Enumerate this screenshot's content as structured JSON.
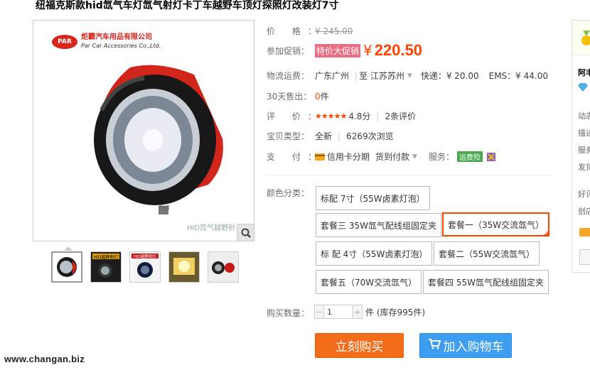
{
  "product": {
    "title": "纽福克斯款hid氙气车灯氙气射灯卡丁车越野车顶灯探照灯改装灯7寸"
  },
  "gallery": {
    "brand_logo": "PAR",
    "brand_cn": "炬霸汽车用品有限公司",
    "brand_en": "Par Car Accessories Co.,Ltd.",
    "watermark": "HID氙气越野射",
    "lamp_label": "PAR",
    "thumb1_banner": "HID越野射灯",
    "thumb3_banner": "HID越野射灯"
  },
  "price": {
    "label": "价 格：",
    "original": "¥ 245.00",
    "promo_label": "参加促销：",
    "promo_tag": "特价大促销",
    "currency": "¥",
    "current": "220.50"
  },
  "shipping": {
    "label": "物流运费：",
    "from": "广东广州",
    "to": "至 江苏苏州",
    "express": "快递：¥ 20.00",
    "ems": "EMS：¥ 44.00"
  },
  "sales": {
    "label": "30天售出：",
    "count": "0",
    "unit": "件"
  },
  "rating": {
    "label": "评 价：",
    "stars": "★★★★★",
    "score": "4.8分",
    "reviews": "2条评价"
  },
  "info": {
    "label": "宝贝类型：",
    "type": "全新",
    "views": "6269次浏览"
  },
  "payment": {
    "label": "支 付：",
    "credit": "信用卡分期",
    "cod": "货到付款",
    "service_label": "服务：",
    "service_badge": "运费险"
  },
  "sku": {
    "label": "颜色分类：",
    "options": [
      "标配 7寸（55W卤素灯泡）",
      "套餐三 35W氙气配线组固定夹",
      "套餐一（35W交流氙气）",
      "标 配 4寸（55W卤素灯泡）",
      "套餐二（55W交流氙气）",
      "套餐五（70W交流氙气）",
      "套餐四 55W氙气配线组固定夹"
    ],
    "selected_index": 2
  },
  "quantity": {
    "label": "购买数量：",
    "value": "1",
    "unit": "件 (库存995件)"
  },
  "actions": {
    "buy": "立刻购买",
    "cart": "加入购物车"
  },
  "shop": {
    "name": "阿丰",
    "items": [
      "动态",
      "描述",
      "服务",
      "发货",
      "好评",
      "创店"
    ]
  },
  "footer": {
    "site": "www.changan.biz"
  },
  "colors": {
    "accent": "#ff4400",
    "buy_button": "#f26d1a",
    "cart_button": "#3d9df0",
    "promo_tag": "#ea6f84"
  }
}
